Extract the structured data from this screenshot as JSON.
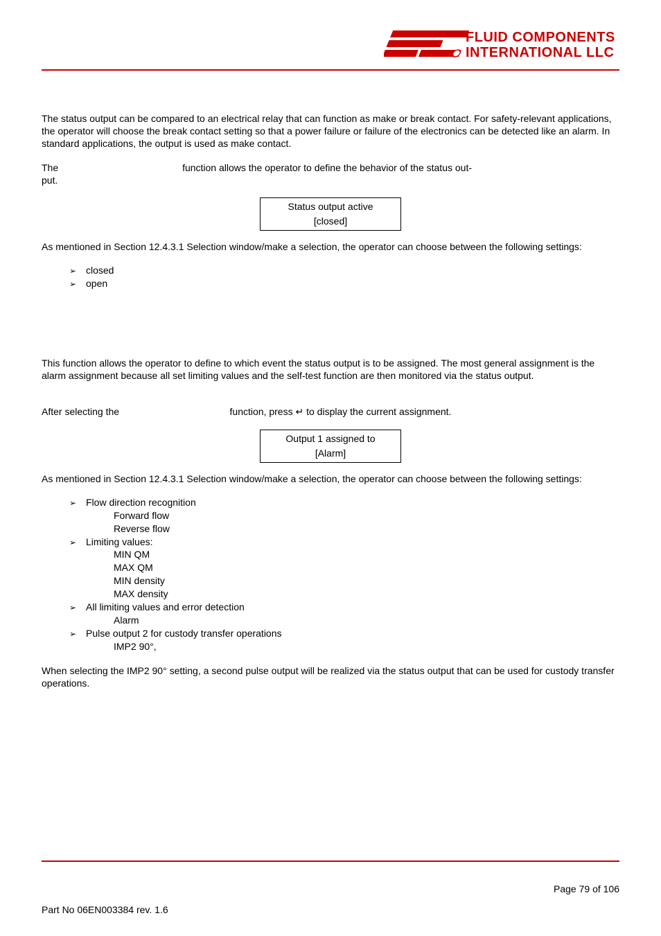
{
  "logo": {
    "line1": "FLUID COMPONENTS",
    "line2": "INTERNATIONAL LLC"
  },
  "section1": {
    "p1": "The status output can be compared to an electrical relay that can function as make or break contact. For safety-relevant applications, the operator will choose the break contact setting so that a power failure or failure of the electronics can be detected like an alarm. In standard applications, the output is used as make contact.",
    "p2_start": "The",
    "p2_mid": "                                              ",
    "p2_end": "function allows the operator to define the behavior of the status out-",
    "p2_line2": "put.",
    "box": {
      "line1": "Status output active",
      "line2": "[closed]"
    },
    "p3": "As mentioned in Section 12.4.3.1 Selection window/make a selection, the operator can choose between the following settings:",
    "bullets": {
      "b1": "closed",
      "b2": "open"
    }
  },
  "section2": {
    "p1": "This function allows the operator to define to which event the status output is to be assigned. The most general assignment is the alarm assignment because all set limiting values and the self-test function are then monitored via the status output.",
    "p2_start": "After selecting the",
    "p2_mid": "                                         ",
    "p2_end": "function, press ↵ to display the current assignment.",
    "box": {
      "line1": "Output 1 assigned to",
      "line2": "[Alarm]"
    },
    "p3": "As mentioned in Section 12.4.3.1 Selection window/make a selection, the operator can choose between the following settings:",
    "bullets": {
      "b1": "Flow direction recognition",
      "b1s1": "Forward flow",
      "b1s2": "Reverse flow",
      "b2": "Limiting values:",
      "b2s1": "MIN QM",
      "b2s2": "MAX QM",
      "b2s3": "MIN density",
      "b2s4": "MAX density",
      "b3": "All limiting values and error detection",
      "b3s1": "Alarm",
      "b4": "Pulse output 2 for custody transfer operations",
      "b4s1": "IMP2 90°,"
    },
    "p4": "When selecting the IMP2 90° setting, a second pulse output will be realized via the status output that can be used for custody transfer operations."
  },
  "footer": {
    "right": "Page 79 of 106",
    "left": "Part No 06EN003384 rev. 1.6"
  },
  "glyphs": {
    "arrow": "➢"
  }
}
